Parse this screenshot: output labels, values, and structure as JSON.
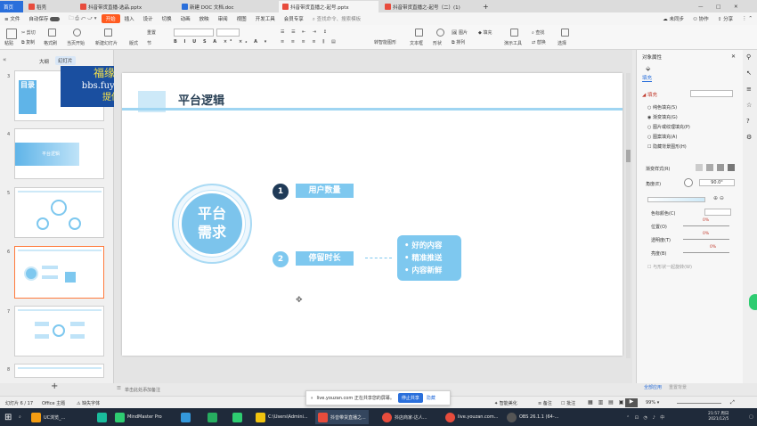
{
  "tabs": [
    {
      "label": "首页",
      "color": "#2a6fdb"
    },
    {
      "label": "稻壳",
      "color": "#e84c3d"
    },
    {
      "label": "抖音带货直播-选品.pptx",
      "color": "#e84c3d"
    },
    {
      "label": "新建 DOC 文档.doc",
      "color": "#2a6fdb"
    },
    {
      "label": "抖音带货直播之-起号.pptx",
      "color": "#e84c3d"
    },
    {
      "label": "抖音带货直播之-起号（二）(1)",
      "color": "#e84c3d"
    }
  ],
  "tab_add": "+",
  "top_right": {
    "sync": "未同步",
    "collab": "协作",
    "share": "分享"
  },
  "menu": {
    "file": "文件",
    "autosave": "自动保存",
    "items": [
      "开始",
      "插入",
      "设计",
      "切换",
      "动画",
      "放映",
      "审阅",
      "视图",
      "开发工具",
      "会员专享"
    ],
    "search_placeholder": "查找命令、搜索模板"
  },
  "ribbon": {
    "paste": "粘贴",
    "cut": "剪切",
    "copy": "复制",
    "format_painter": "格式刷",
    "from_current": "当页开始",
    "new_slide": "新建幻灯片",
    "layout": "版式",
    "section": "节",
    "reset": "重置",
    "shape": "形状",
    "arrange": "排列",
    "picture": "图片",
    "fill": "填充",
    "textbox": "文本框",
    "find": "查找",
    "replace": "替换",
    "select": "选择",
    "convert_chart": "转智能图形",
    "slides_tool": "演示工具"
  },
  "left_pane": {
    "tab_outline": "大纲",
    "tab_slides": "幻灯片",
    "slide_numbers": [
      "3",
      "4",
      "5",
      "6",
      "7",
      "8"
    ],
    "thumb3_title": "目录",
    "thumb4_title": "平台逻辑",
    "add": "+"
  },
  "watermark": {
    "line1": "福缘创业网",
    "line2": "bbs.fuyuan6.com",
    "line3": "提供下载"
  },
  "slide": {
    "title": "平台逻辑",
    "center_line1": "平台",
    "center_line2": "需求",
    "item1_num": "1",
    "item1_label": "用户数量",
    "item2_num": "2",
    "item2_label": "停留时长",
    "bullets": [
      "好的内容",
      "精准推送",
      "内容新鲜"
    ],
    "colors": {
      "accent": "#7ec8ef",
      "dark": "#1f3a57",
      "title_bar": "#cde9f8"
    }
  },
  "right_pane": {
    "header": "对象属性",
    "tab_fill": "填充",
    "section_fill": "填充",
    "options": [
      "纯色填充(S)",
      "渐变填充(G)",
      "图片或纹理填充(P)",
      "图案填充(A)",
      "隐藏背景图形(H)"
    ],
    "gradient_style": "渐变样式(R)",
    "angle_label": "角度(E)",
    "angle_value": "90.0°",
    "color_stop": "色标颜色(C)",
    "position": "位置(O)",
    "position_value": "0%",
    "transparency": "透明度(T)",
    "transparency_value": "0%",
    "brightness": "亮度(B)",
    "brightness_value": "0%",
    "rotate_with_shape": "与形状一起旋转(W)",
    "apply_all": "全部应用",
    "reset_bg": "重置背景"
  },
  "status": {
    "slide_info": "幻灯片 6 / 17",
    "theme": "Office 主题",
    "font_missing": "缺失字体",
    "notes": "单击此处添加备注",
    "smart_beautify": "智能美化",
    "comments": "备注",
    "annotations": "批注",
    "zoom": "99%"
  },
  "share_popup": {
    "text": "live.youzan.com 正在共享您的屏幕。",
    "stop": "停止共享",
    "hide": "隐藏"
  },
  "taskbar": {
    "items": [
      {
        "label": "UC浏览_...",
        "color": "#f39c12"
      },
      {
        "label": "",
        "color": "#1abc9c"
      },
      {
        "label": "MindMaster Pro",
        "color": "#2ecc71"
      },
      {
        "label": "",
        "color": "#3498db"
      },
      {
        "label": "",
        "color": "#27ae60"
      },
      {
        "label": "",
        "color": "#2ecc71"
      },
      {
        "label": "C:\\Users\\Admini...",
        "color": "#f1c40f"
      },
      {
        "label": "抖音带货直播之...",
        "color": "#e74c3c"
      },
      {
        "label": "抖店商家-达人...",
        "color": "#e74c3c"
      },
      {
        "label": "live.youzan.com...",
        "color": "#e74c3c"
      },
      {
        "label": "OBS 26.1.1 (64-...",
        "color": "#555555"
      }
    ],
    "time": "21:57 周日",
    "date": "2021/12/5"
  }
}
